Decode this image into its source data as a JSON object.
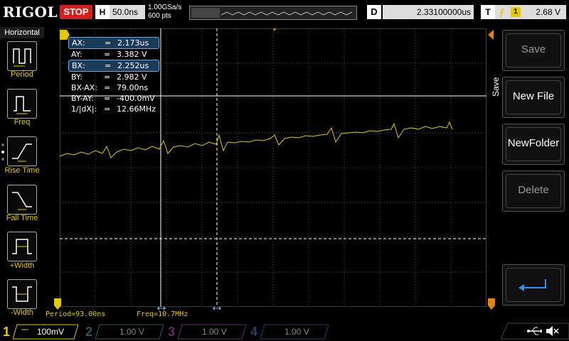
{
  "top": {
    "logo": "RIGOL",
    "status": "STOP",
    "h_label": "H",
    "h_value": "50.0ns",
    "sample_rate": "1.00GSa/s",
    "points": "600 pts",
    "d_label": "D",
    "d_value": "2.33100000us",
    "trig_label": "T",
    "trig_channel": "1",
    "trig_level": "2.68 V"
  },
  "left": {
    "title": "Horizontal",
    "items": [
      {
        "label": "Period"
      },
      {
        "label": "Freq"
      },
      {
        "label": "Rise Time"
      },
      {
        "label": "Fall Time"
      },
      {
        "label": "+Width"
      },
      {
        "label": "-Width"
      }
    ]
  },
  "cursor": {
    "rows": [
      {
        "k": "AX:",
        "eq": "=",
        "v": "2.173us"
      },
      {
        "k": "AY:",
        "eq": "=",
        "v": "3.382 V"
      },
      {
        "k": "BX:",
        "eq": "=",
        "v": "2.252us"
      },
      {
        "k": "BY:",
        "eq": "=",
        "v": "2.982 V"
      },
      {
        "k": "BX-AX:",
        "eq": "=",
        "v": "79.00ns"
      },
      {
        "k": "BY-AY:",
        "eq": "=",
        "v": "-400.0mV"
      },
      {
        "k": "1/|dX|:",
        "eq": "=",
        "v": "12.66MHz"
      }
    ]
  },
  "measure": {
    "period": "Period=93.00ns",
    "freq": "Freq=10.7MHz"
  },
  "right": {
    "side_title": "Save",
    "buttons": [
      "Save",
      "New File",
      "NewFolder",
      "Delete"
    ]
  },
  "bottom": {
    "channels": [
      {
        "num": "1",
        "scale": "100mV",
        "active": true
      },
      {
        "num": "2",
        "scale": "1.00 V",
        "active": false
      },
      {
        "num": "3",
        "scale": "1.00 V",
        "active": false
      },
      {
        "num": "4",
        "scale": "1.00 V",
        "active": false
      }
    ]
  },
  "colors": {
    "ch1": "#e5c900",
    "ch2": "#28c8c8",
    "ch3": "#d040d0",
    "ch4": "#3a70e0",
    "stop": "#d62020",
    "cursor_sel": "#1b3a5a"
  }
}
